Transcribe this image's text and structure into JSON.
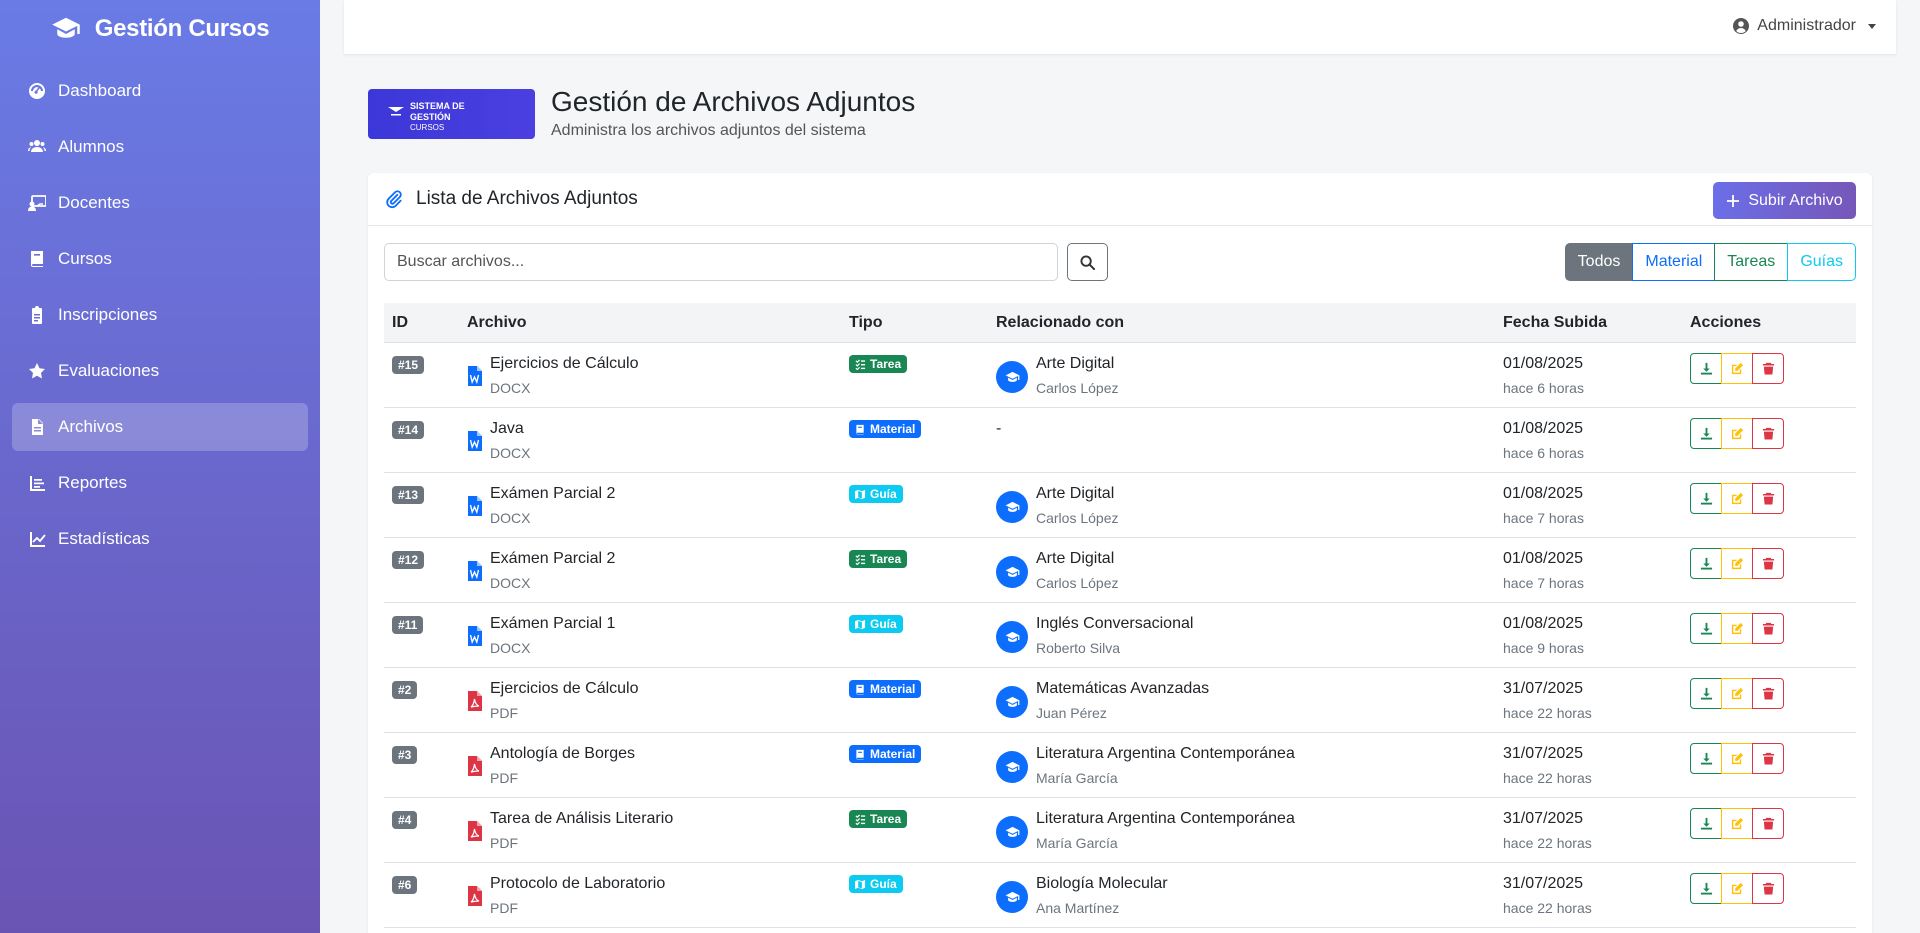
{
  "sidebar": {
    "brand": "Gestión Cursos",
    "items": [
      {
        "label": "Dashboard",
        "icon": "gauge-icon"
      },
      {
        "label": "Alumnos",
        "icon": "users-icon"
      },
      {
        "label": "Docentes",
        "icon": "teacher-icon"
      },
      {
        "label": "Cursos",
        "icon": "book-icon"
      },
      {
        "label": "Inscripciones",
        "icon": "clipboard-icon"
      },
      {
        "label": "Evaluaciones",
        "icon": "star-icon"
      },
      {
        "label": "Archivos",
        "icon": "file-icon",
        "active": true
      },
      {
        "label": "Reportes",
        "icon": "report-icon"
      },
      {
        "label": "Estadísticas",
        "icon": "chart-line-icon"
      }
    ]
  },
  "topbar": {
    "user": "Administrador"
  },
  "header": {
    "logo_line1": "SISTEMA DE",
    "logo_line2": "GESTIÓN",
    "logo_line3": "CURSOS",
    "title": "Gestión de Archivos Adjuntos",
    "subtitle": "Administra los archivos adjuntos del sistema"
  },
  "card": {
    "title": "Lista de Archivos Adjuntos",
    "upload_label": "Subir Archivo",
    "search_placeholder": "Buscar archivos...",
    "filters": [
      "Todos",
      "Material",
      "Tareas",
      "Guías"
    ],
    "columns": [
      "ID",
      "Archivo",
      "Tipo",
      "Relacionado con",
      "Fecha Subida",
      "Acciones"
    ]
  },
  "colors": {
    "tarea": "#198754",
    "material": "#0d6efd",
    "guia": "#0dcaf0",
    "word": "#0d6efd",
    "pdf": "#dc3545"
  },
  "rows": [
    {
      "id": "#15",
      "name": "Ejercicios de Cálculo",
      "ext": "DOCX",
      "type": "Tarea",
      "course": "Arte Digital",
      "teacher": "Carlos López",
      "date": "01/08/2025",
      "ago": "hace 6 horas"
    },
    {
      "id": "#14",
      "name": "Java",
      "ext": "DOCX",
      "type": "Material",
      "course": "",
      "teacher": "",
      "dash": "-",
      "date": "01/08/2025",
      "ago": "hace 6 horas"
    },
    {
      "id": "#13",
      "name": "Exámen Parcial 2",
      "ext": "DOCX",
      "type": "Guía",
      "course": "Arte Digital",
      "teacher": "Carlos López",
      "date": "01/08/2025",
      "ago": "hace 7 horas"
    },
    {
      "id": "#12",
      "name": "Exámen Parcial 2",
      "ext": "DOCX",
      "type": "Tarea",
      "course": "Arte Digital",
      "teacher": "Carlos López",
      "date": "01/08/2025",
      "ago": "hace 7 horas"
    },
    {
      "id": "#11",
      "name": "Exámen Parcial 1",
      "ext": "DOCX",
      "type": "Guía",
      "course": "Inglés Conversacional",
      "teacher": "Roberto Silva",
      "date": "01/08/2025",
      "ago": "hace 9 horas"
    },
    {
      "id": "#2",
      "name": "Ejercicios de Cálculo",
      "ext": "PDF",
      "type": "Material",
      "course": "Matemáticas Avanzadas",
      "teacher": "Juan Pérez",
      "date": "31/07/2025",
      "ago": "hace 22 horas"
    },
    {
      "id": "#3",
      "name": "Antología de Borges",
      "ext": "PDF",
      "type": "Material",
      "course": "Literatura Argentina Contemporánea",
      "teacher": "María García",
      "date": "31/07/2025",
      "ago": "hace 22 horas"
    },
    {
      "id": "#4",
      "name": "Tarea de Análisis Literario",
      "ext": "PDF",
      "type": "Tarea",
      "course": "Literatura Argentina Contemporánea",
      "teacher": "María García",
      "date": "31/07/2025",
      "ago": "hace 22 horas"
    },
    {
      "id": "#6",
      "name": "Protocolo de Laboratorio",
      "ext": "PDF",
      "type": "Guía",
      "course": "Biología Molecular",
      "teacher": "Ana Martínez",
      "date": "31/07/2025",
      "ago": "hace 22 horas"
    }
  ]
}
